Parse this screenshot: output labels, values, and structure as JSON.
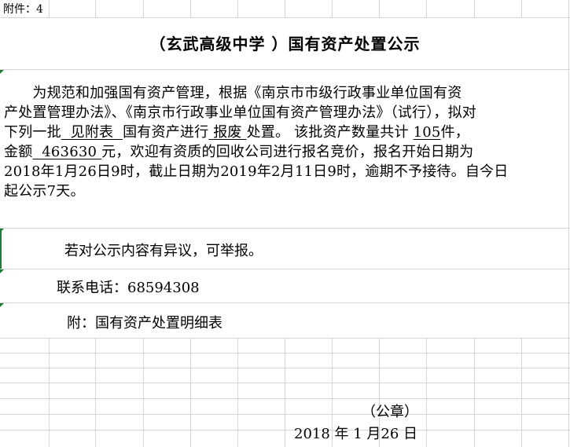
{
  "header": {
    "attachment_label": "附件：4"
  },
  "title": "（玄武高级中学 ）国有资产处置公示",
  "notice": {
    "line1": "　　为规范和加强国有资产管理，根据《南京市市级行政事业单位国有资",
    "line2": "产处置管理办法》、《南京市行政事业单位国有资产管理办法》（试行），拟对",
    "line3_a": "下列一批",
    "line3_u1": "  见附表  ",
    "line3_b": "国有资产进行",
    "line3_u2": " 报废 ",
    "line3_c": "处置。 该批资产数量共计 ",
    "line3_u3": "105",
    "line3_d": "件，",
    "line4_a": "金额",
    "line4_u": "  463630 ",
    "line4_b": "元，欢迎有资质的回收公司进行报名竞价，报名开始日期为",
    "line5": "2018年1月26日9时，截止日期为2019年2月11日9时，逾期不予接待。自今日",
    "line6": "起公示7天。"
  },
  "objection": "若对公示内容有异议，可举报。",
  "contact_phone": "联系电话：68594308",
  "annex": "附：国有资产处置明细表",
  "seal": "（公章）",
  "date": "2018 年 1 月26 日"
}
